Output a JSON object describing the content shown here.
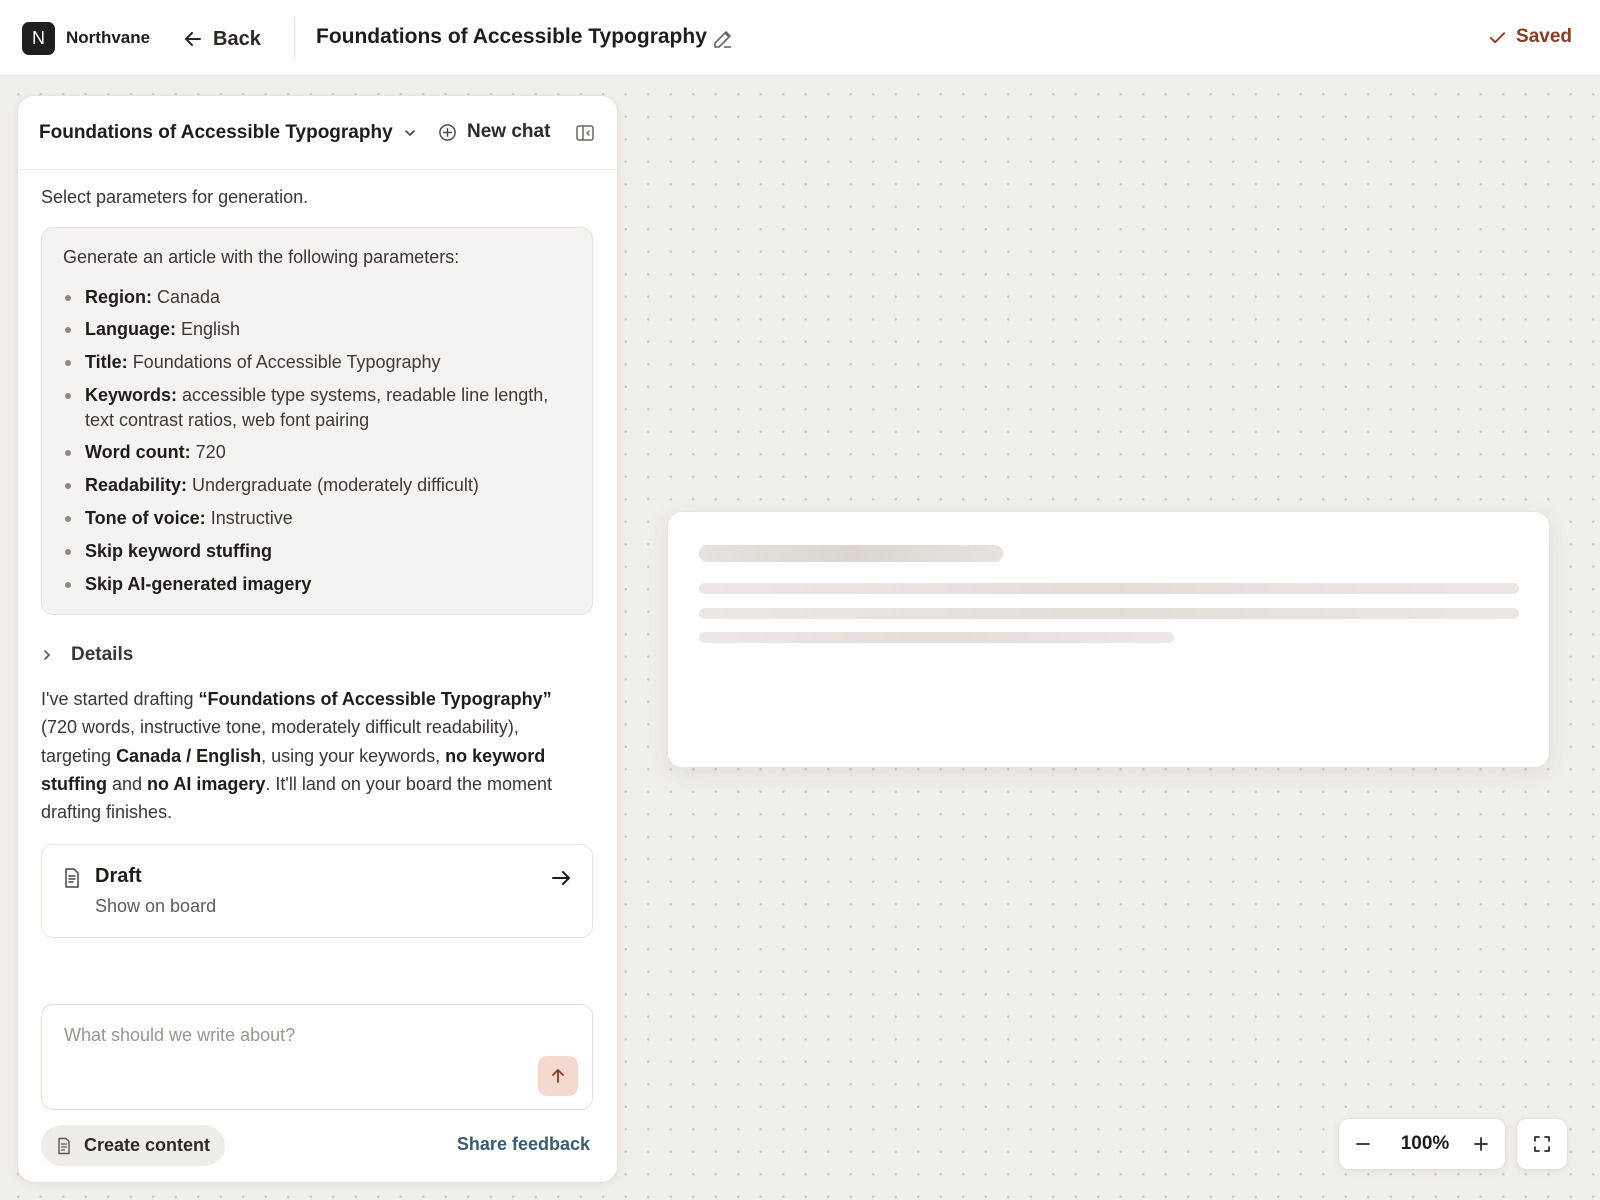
{
  "app": {
    "logo_letter": "N",
    "brand": "Northvane"
  },
  "topbar": {
    "back_label": "Back",
    "document_title": "Foundations of Accessible Typography",
    "saved_label": "Saved"
  },
  "chat": {
    "title": "Foundations of Accessible Typography",
    "new_chat_label": "New chat",
    "intro": "Select parameters for generation.",
    "params_heading": "Generate an article with the following parameters:",
    "params": [
      {
        "label": "Region:",
        "value": "Canada"
      },
      {
        "label": "Language:",
        "value": "English"
      },
      {
        "label": "Title:",
        "value": "Foundations of Accessible Typography"
      },
      {
        "label": "Keywords:",
        "value": "accessible type systems, readable line length, text contrast ratios, web font pairing"
      },
      {
        "label": "Word count:",
        "value": "720"
      },
      {
        "label": "Readability:",
        "value": "Undergraduate (moderately difficult)"
      },
      {
        "label": "Tone of voice:",
        "value": "Instructive"
      },
      {
        "label": "Skip keyword stuffing",
        "value": ""
      },
      {
        "label": "Skip AI-generated imagery",
        "value": ""
      }
    ],
    "details_label": "Details",
    "summary": {
      "t1": "I've started drafting ",
      "b1": "“Foundations of Accessible Typography”",
      "t2": " (720 words, instructive tone, moderately difficult readability), targeting ",
      "b2": "Canada / English",
      "t3": ", using your keywords, ",
      "b3": "no keyword stuffing",
      "t4": " and ",
      "b4": "no AI imagery",
      "t5": ". It'll land on your board the moment drafting finishes."
    },
    "draft_card": {
      "title": "Draft",
      "subtitle": "Show on board"
    },
    "composer": {
      "placeholder": "What should we write about?",
      "value": ""
    },
    "create_content_label": "Create content",
    "share_feedback_label": "Share feedback"
  },
  "board": {
    "zoom_level": "100%"
  },
  "colors": {
    "accent": "#8a3b22",
    "send_button_bg": "#f4d9cf",
    "link": "#3d5a73",
    "canvas_bg": "#f1efeb"
  },
  "icons": [
    "back-arrow-icon",
    "pencil-icon",
    "check-icon",
    "chevron-down-icon",
    "plus-circle-icon",
    "sidebar-collapse-icon",
    "chevron-right-icon",
    "document-icon",
    "arrow-right-icon",
    "arrow-up-icon",
    "minus-icon",
    "plus-icon",
    "fullscreen-icon"
  ]
}
